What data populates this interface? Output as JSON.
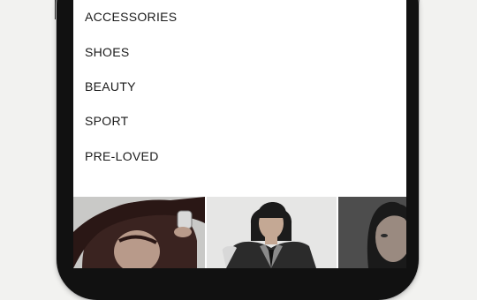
{
  "menu": {
    "items": [
      {
        "label": "ACCESSORIES"
      },
      {
        "label": "SHOES"
      },
      {
        "label": "BEAUTY"
      },
      {
        "label": "SPORT"
      },
      {
        "label": "PRE-LOVED"
      }
    ]
  },
  "tiles": [
    {
      "name": "woman-portrait-tile",
      "bg": "#c9c9c7"
    },
    {
      "name": "man-jacket-tile",
      "bg": "#e6e6e5"
    },
    {
      "name": "man-portrait-tile",
      "bg": "#4d4d4d"
    }
  ],
  "colors": {
    "frame": "#111111",
    "background": "#f2f2f0",
    "text": "#1a1a1a"
  }
}
